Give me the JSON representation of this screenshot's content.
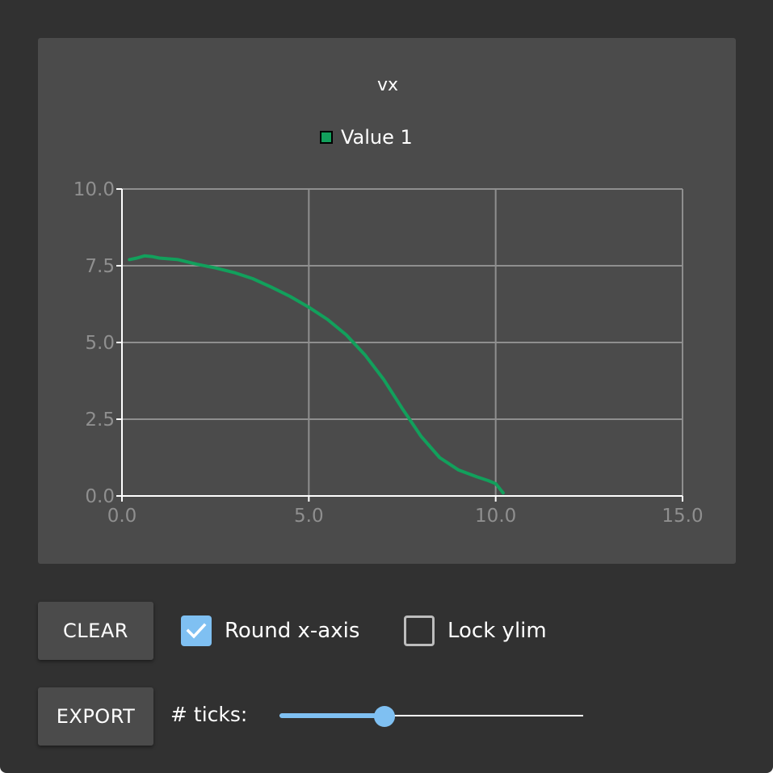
{
  "colors": {
    "background": "#313131",
    "panel": "#4b4b4b",
    "series": "#12a05c",
    "accent": "#7fc0f2",
    "grid": "#8f8f8f"
  },
  "chart_data": {
    "type": "line",
    "title": "vx",
    "xlabel": "",
    "ylabel": "",
    "xlim": [
      0,
      15
    ],
    "ylim": [
      0,
      10
    ],
    "x_ticks": [
      0,
      5,
      10,
      15
    ],
    "x_tick_labels": [
      "0.0",
      "5.0",
      "10.0",
      "15.0"
    ],
    "y_ticks": [
      0,
      2.5,
      5,
      7.5,
      10
    ],
    "y_tick_labels": [
      "0.0",
      "2.5",
      "5.0",
      "7.5",
      "10.0"
    ],
    "grid": true,
    "legend_placement": "top-center",
    "series": [
      {
        "name": "Value 1",
        "color": "#12a05c",
        "x": [
          0.2,
          0.4,
          0.6,
          0.8,
          1.0,
          1.5,
          2.0,
          2.5,
          3.0,
          3.5,
          4.0,
          4.5,
          5.0,
          5.5,
          6.0,
          6.5,
          7.0,
          7.5,
          8.0,
          8.5,
          9.0,
          9.5,
          9.8,
          10.0,
          10.2
        ],
        "y": [
          7.7,
          7.75,
          7.82,
          7.8,
          7.75,
          7.7,
          7.55,
          7.43,
          7.28,
          7.08,
          6.8,
          6.5,
          6.15,
          5.75,
          5.25,
          4.6,
          3.8,
          2.85,
          1.95,
          1.25,
          0.85,
          0.62,
          0.5,
          0.4,
          0.1
        ]
      }
    ]
  },
  "controls": {
    "clear_label": "CLEAR",
    "export_label": "EXPORT",
    "round_x_label": "Round x-axis",
    "round_x_checked": true,
    "lock_ylim_label": "Lock ylim",
    "lock_ylim_checked": false,
    "ticks_label": "# ticks:",
    "ticks_slider_fraction": 0.345
  }
}
